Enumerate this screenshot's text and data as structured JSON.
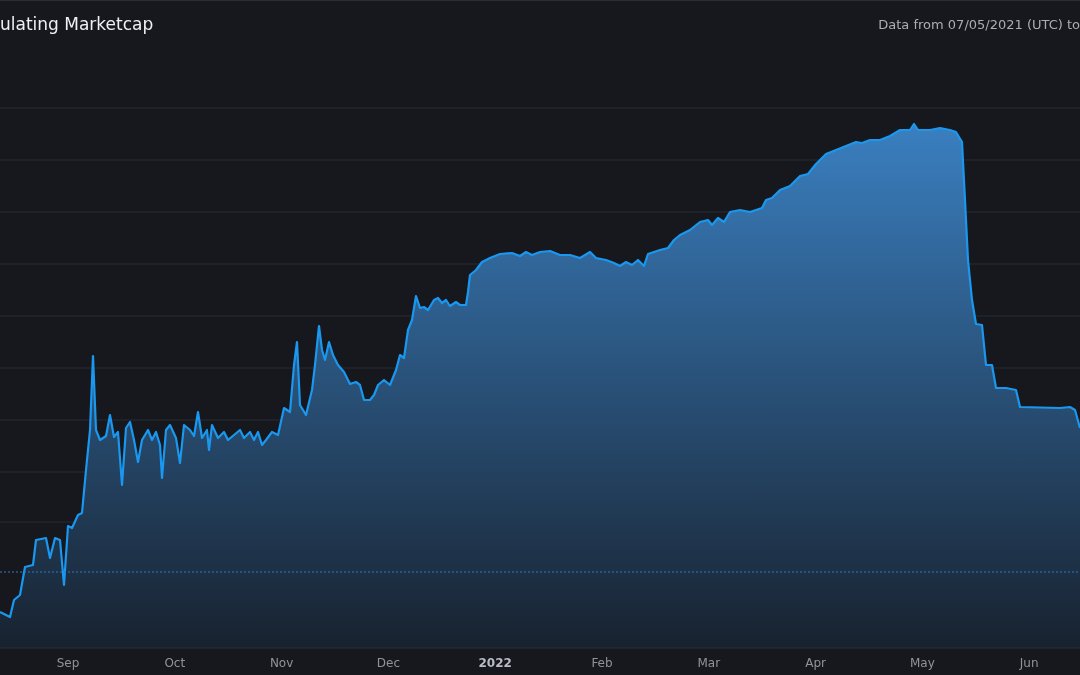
{
  "header": {
    "title": "ulating Marketcap",
    "date_range": "Data from 07/05/2021 (UTC) to"
  },
  "chart": {
    "x_labels": [
      {
        "label": "Sep",
        "kind": "month"
      },
      {
        "label": "Oct",
        "kind": "month"
      },
      {
        "label": "Nov",
        "kind": "month"
      },
      {
        "label": "Dec",
        "kind": "month"
      },
      {
        "label": "2022",
        "kind": "year"
      },
      {
        "label": "Feb",
        "kind": "month"
      },
      {
        "label": "Mar",
        "kind": "month"
      },
      {
        "label": "Apr",
        "kind": "month"
      },
      {
        "label": "May",
        "kind": "month"
      },
      {
        "label": "Jun",
        "kind": "month"
      }
    ]
  }
}
